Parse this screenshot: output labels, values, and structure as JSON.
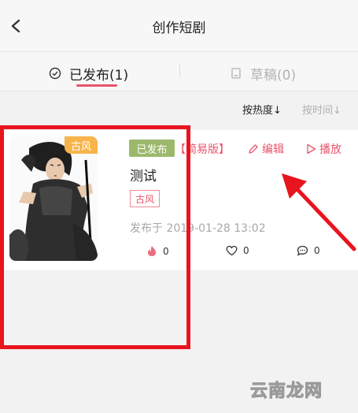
{
  "header": {
    "title": "创作短剧",
    "back_icon": "chevron-left-icon"
  },
  "tabs": [
    {
      "label": "已发布(1)",
      "icon": "check-circle-icon",
      "active": true
    },
    {
      "label": "草稿(0)",
      "icon": "document-icon",
      "active": false
    }
  ],
  "sort": {
    "by_heat": "按热度",
    "by_time": "按时间"
  },
  "card": {
    "cover_tag": "古风",
    "status": "已发布",
    "version": "【简易版】",
    "edit_label": "编辑",
    "play_label": "播放",
    "title": "测试",
    "genre": "古风",
    "publish_time": "发布于 2019-01-28 13:02",
    "stats": {
      "heat": "0",
      "likes": "0",
      "comments": "0"
    }
  },
  "watermark": "云南龙网",
  "colors": {
    "accent": "#e8546a",
    "status_green": "#9cb86d",
    "tag_orange": "#f7b44a",
    "annotation_red": "#e8141e"
  }
}
